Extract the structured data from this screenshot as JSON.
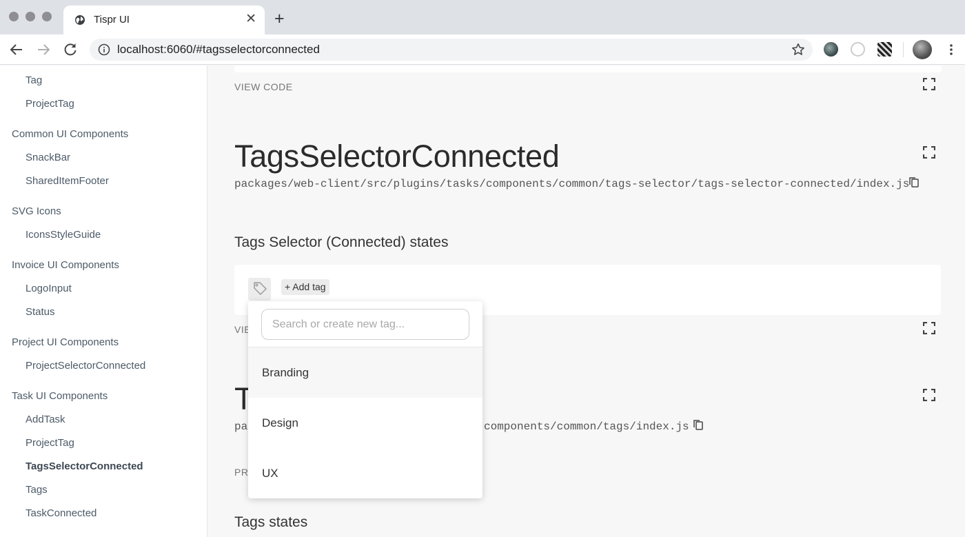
{
  "browser": {
    "tab_title": "Tispr UI",
    "url": "localhost:6060/#tagsselectorconnected"
  },
  "sidebar": {
    "items": [
      {
        "label": "Tag",
        "kind": "item"
      },
      {
        "label": "ProjectTag",
        "kind": "item"
      },
      {
        "label": "Common UI Components",
        "kind": "group"
      },
      {
        "label": "SnackBar",
        "kind": "item"
      },
      {
        "label": "SharedItemFooter",
        "kind": "item"
      },
      {
        "label": "SVG Icons",
        "kind": "group"
      },
      {
        "label": "IconsStyleGuide",
        "kind": "item"
      },
      {
        "label": "Invoice UI Components",
        "kind": "group"
      },
      {
        "label": "LogoInput",
        "kind": "item"
      },
      {
        "label": "Status",
        "kind": "item"
      },
      {
        "label": "Project UI Components",
        "kind": "group"
      },
      {
        "label": "ProjectSelectorConnected",
        "kind": "item"
      },
      {
        "label": "Task UI Components",
        "kind": "group"
      },
      {
        "label": "AddTask",
        "kind": "item"
      },
      {
        "label": "ProjectTag",
        "kind": "item"
      },
      {
        "label": "TagsSelectorConnected",
        "kind": "item",
        "active": true
      },
      {
        "label": "Tags",
        "kind": "item"
      },
      {
        "label": "TaskConnected",
        "kind": "item"
      }
    ]
  },
  "main": {
    "view_code_top": "VIEW CODE",
    "component1": {
      "title": "TagsSelectorConnected",
      "path": "packages/web-client/src/plugins/tasks/components/common/tags-selector/tags-selector-connected/index.js",
      "section_title": "Tags Selector (Connected) states",
      "add_tag_label": "+ Add tag",
      "view_code_partial": "VIE"
    },
    "component2": {
      "title_partial": "T",
      "path_prefix": "pa",
      "path_suffix": "components/common/tags/index.js",
      "props_partial": "PR",
      "section_title": "Tags states"
    }
  },
  "dropdown": {
    "search_placeholder": "Search or create new tag...",
    "options": [
      "Branding",
      "Design",
      "UX"
    ],
    "hovered_option": "Branding"
  }
}
